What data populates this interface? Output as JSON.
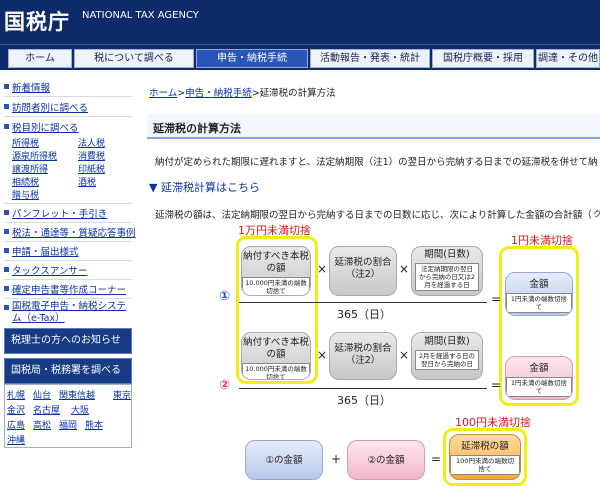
{
  "header": {
    "logo": "国税庁",
    "agency": "NATIONAL TAX AGENCY"
  },
  "gnav": {
    "items": [
      "ホーム",
      "税について調べる",
      "申告・納税手続",
      "活動報告・発表・統計",
      "国税庁概要・採用",
      "調達・その他"
    ]
  },
  "sidebar": {
    "links": [
      "新着情報",
      "訪問者別に調べる",
      "税目別に調べる"
    ],
    "taxes": [
      "所得税",
      "法人税",
      "源泉所得税",
      "消費税",
      "譲渡所得",
      "印紙税",
      "相続税",
      "酒税",
      "贈与税"
    ],
    "more": [
      "パンフレット・手引き",
      "税法・通達等・質疑応答事例",
      "申請・届出様式",
      "タックスアンサー",
      "確定申告書等作成コーナー",
      "国税電子申告・納税システム（e-Tax）"
    ],
    "box1": "税理士の方へのお知らせ",
    "box2": "国税局・税務署を調べる",
    "regions": [
      "札幌",
      "仙台",
      "関東信越",
      "東京",
      "金沢",
      "名古屋",
      "大阪",
      "広島",
      "高松",
      "福岡",
      "熊本",
      "沖縄"
    ]
  },
  "main": {
    "breadcrumb": {
      "home": "ホーム",
      "tetsuzuki": "申告・納税手続",
      "current": "延滞税の計算方法",
      "sep1": ">",
      "sep2": ">",
      "sep3": ">"
    },
    "title": "延滞税の計算方法",
    "intro": "納付が定められた期限に遅れますと、法定納期限（注1）の翌日から完納する日までの延滞税を併せて納",
    "calc_link": "▼ 延滞税計算はこちら",
    "desc": "延滞税の額は、法定納期限の翌日から完納する日までの日数に応じ、次により計算した金額の合計額（",
    "scroll_hint": "ク",
    "annotations": {
      "a1": "1万円未満切捨",
      "a2": "1円未満切捨",
      "a3": "100円未満切捨"
    },
    "formula1": {
      "marker": "①",
      "principal": "納付すべき本税の額",
      "principal_note": "10,000円未満の端数切捨て",
      "rate": "延滞税の割合",
      "rate_note": "（注2）",
      "period": "期間(日数)",
      "period_note": "法定納期限の翌日から完納の日又は2月を経過する日",
      "days": "365（日）",
      "result": "金額",
      "result_note": "1円未満の端数切捨て"
    },
    "formula2": {
      "marker": "②",
      "principal": "納付すべき本税の額",
      "principal_note": "10,000円未満の端数切捨て",
      "rate": "延滞税の割合",
      "rate_note": "（注2）",
      "period": "期間(日数)",
      "period_note": "2月を経過する日の翌日から完納の日",
      "days": "365（日）",
      "result": "金額",
      "result_note": "1円未満の端数切捨て"
    },
    "formula3": {
      "sum1": "①の金額",
      "sum2": "②の金額",
      "result": "延滞税の額",
      "result_note": "100円未満の端数切捨て"
    },
    "ops": {
      "times": "×",
      "equals": "=",
      "plus": "+"
    }
  },
  "colors": {
    "navy": "#0d2b6b",
    "highlight": "#f4ec18",
    "annotation": "#d21919",
    "link": "#0a32a0"
  }
}
